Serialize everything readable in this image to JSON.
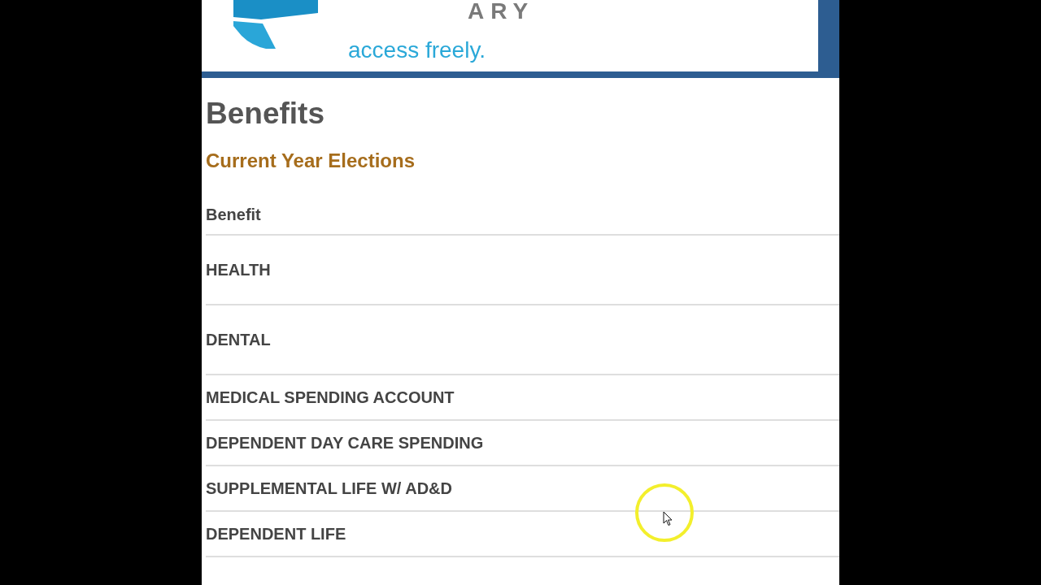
{
  "header": {
    "logo": {
      "wordmark": "ARY",
      "tagline": "access freely."
    }
  },
  "page": {
    "title": "Benefits",
    "subtitle": "Current Year Elections"
  },
  "table": {
    "columns": [
      "Benefit"
    ],
    "rows": [
      {
        "benefit": "HEALTH"
      },
      {
        "benefit": "DENTAL"
      },
      {
        "benefit": "MEDICAL SPENDING ACCOUNT"
      },
      {
        "benefit": "DEPENDENT DAY CARE SPENDING"
      },
      {
        "benefit": "SUPPLEMENTAL LIFE W/ AD&D"
      },
      {
        "benefit": "DEPENDENT LIFE"
      }
    ]
  }
}
